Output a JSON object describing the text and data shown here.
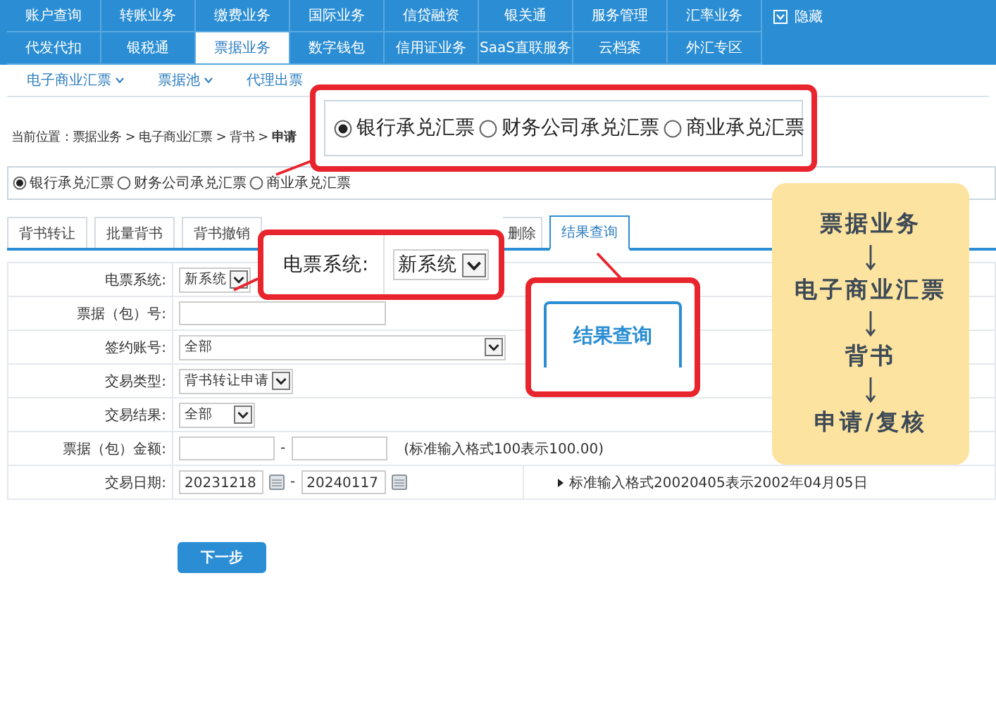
{
  "main_menu": {
    "rows": [
      [
        {
          "label": "账户查询",
          "selected": false
        },
        {
          "label": "转账业务",
          "selected": false
        },
        {
          "label": "缴费业务",
          "selected": false
        },
        {
          "label": "国际业务",
          "selected": false
        },
        {
          "label": "信贷融资",
          "selected": false
        },
        {
          "label": "银关通",
          "selected": false
        },
        {
          "label": "服务管理",
          "selected": false
        },
        {
          "label": "汇率业务",
          "selected": false
        }
      ],
      [
        {
          "label": "代发代扣",
          "selected": false
        },
        {
          "label": "银税通",
          "selected": false
        },
        {
          "label": "票据业务",
          "selected": true
        },
        {
          "label": "数字钱包",
          "selected": false
        },
        {
          "label": "信用证业务",
          "selected": false
        },
        {
          "label": "SaaS直联服务",
          "selected": false
        },
        {
          "label": "云档案",
          "selected": false
        },
        {
          "label": "外汇专区",
          "selected": false
        }
      ]
    ],
    "hide_label": "隐藏"
  },
  "sub_menu": [
    {
      "label": "电子商业汇票",
      "has_dropdown": true
    },
    {
      "label": "票据池",
      "has_dropdown": true
    },
    {
      "label": "代理出票",
      "has_dropdown": false
    }
  ],
  "breadcrumb": "当前位置：票据业务 > 电子商业汇票 > 背书 > **申请**",
  "bill_types": [
    {
      "label": "银行承兑汇票",
      "selected": true
    },
    {
      "label": "财务公司承兑汇票",
      "selected": false
    },
    {
      "label": "商业承兑汇票",
      "selected": false
    }
  ],
  "tabs": [
    {
      "label": "背书转让",
      "selected": false
    },
    {
      "label": "批量背书",
      "selected": false
    },
    {
      "label": "背书撤销",
      "selected": false
    },
    {
      "label": "删除",
      "selected": false
    },
    {
      "label": "结果查询",
      "selected": true
    }
  ],
  "form": {
    "rows": [
      {
        "label": "电票系统:",
        "kind": "select",
        "value": "新系统"
      },
      {
        "label": "票据（包）号:",
        "kind": "text"
      },
      {
        "label": "签约账号:",
        "kind": "wide_select",
        "value": "全部"
      },
      {
        "label": "交易类型:",
        "kind": "select",
        "value": "背书转让申请"
      },
      {
        "label": "交易结果:",
        "kind": "short_select",
        "value": "全部"
      },
      {
        "label": "票据（包）金额:",
        "kind": "range",
        "separator": "-",
        "note": "(标准输入格式100表示100.00)"
      },
      {
        "label": "交易日期:",
        "kind": "date_range",
        "from": "20231218",
        "separator": "-",
        "to": "20240117",
        "note": "标准输入格式20020405表示2002年04月05日"
      }
    ]
  },
  "next_button": "下一步",
  "callouts": {
    "bill_types": [
      {
        "label": "银行承兑汇票",
        "selected": true
      },
      {
        "label": "财务公司承兑汇票",
        "selected": false
      },
      {
        "label": "商业承兑汇票",
        "selected": false
      }
    ],
    "system": {
      "label": "电票系统:",
      "value": "新系统"
    },
    "tab": {
      "label": "结果查询"
    }
  },
  "flow_note": {
    "steps": [
      "票据业务",
      "电子商业汇票",
      "背书",
      "申请/复核"
    ]
  }
}
